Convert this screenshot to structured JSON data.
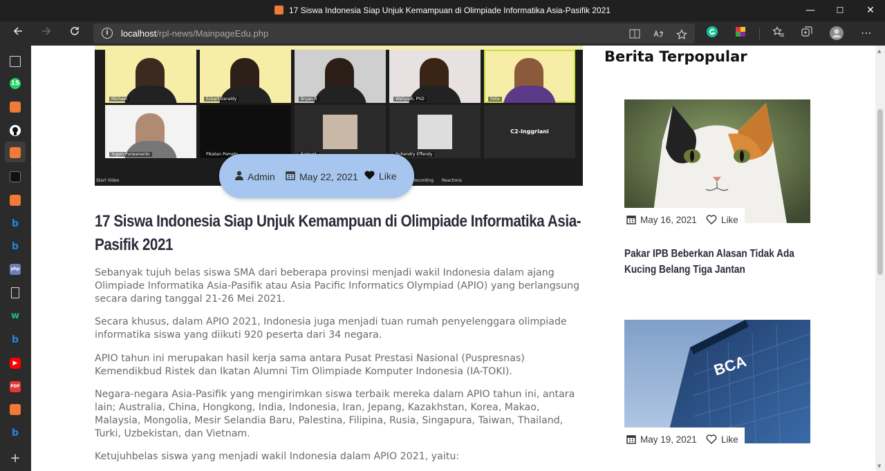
{
  "window": {
    "title": "17 Siswa Indonesia Siap Unjuk Kemampuan di Olimpiade Informatika Asia-Pasifik 2021",
    "controls": {
      "minimize": "—",
      "maximize": "☐",
      "close": "✕"
    }
  },
  "addressbar": {
    "url_host": "localhost",
    "url_path": "/rpl-news/MainpageEdu.php",
    "info_icon": "i"
  },
  "sidebar": {
    "badge_count": "15"
  },
  "hero": {
    "participants": [
      {
        "name": "Michael"
      },
      {
        "name": "Eckart Geraldy"
      },
      {
        "name": "Bryan R"
      },
      {
        "name": "Wahyudi, PhD"
      },
      {
        "name": "Felix"
      },
      {
        "name": "Yugen Purwananto"
      },
      {
        "name": "Pikatan Pomelo"
      },
      {
        "name": "Samuel"
      },
      {
        "name": "Suhendry Effendy"
      },
      {
        "name": "C2-Inggriani"
      }
    ],
    "toolbar": {
      "video": "Start Video",
      "recording": "Recording",
      "reactions": "Reactions"
    }
  },
  "article_meta": {
    "author": "Admin",
    "date": "May 22, 2021",
    "like": "Like"
  },
  "article": {
    "title": "17 Siswa Indonesia Siap Unjuk Kemampuan di Olimpiade Informatika Asia-Pasifik 2021",
    "paragraphs": [
      "Sebanyak tujuh belas siswa SMA dari beberapa provinsi menjadi wakil Indonesia dalam ajang Olimpiade Informatika Asia-Pasifik atau Asia Pacific Informatics Olympiad (APIO) yang berlangsung secara daring tanggal 21-26 Mei 2021.",
      "Secara khusus, dalam APIO 2021, Indonesia juga menjadi tuan rumah penyelenggara olimpiade informatika siswa yang diikuti 920 peserta dari 34 negara.",
      "APIO tahun ini merupakan hasil kerja sama antara Pusat Prestasi Nasional (Puspresnas) Kemendikbud Ristek dan Ikatan Alumni Tim Olimpiade Komputer Indonesia (IA-TOKI).",
      "Negara-negara Asia-Pasifik yang mengirimkan siswa terbaik mereka dalam APIO tahun ini, antara lain; Australia, China, Hongkong, India, Indonesia, Iran, Jepang, Kazakhstan, Korea, Makao, Malaysia, Mongolia, Mesir Selandia Baru, Palestina, Filipina, Rusia, Singapura, Taiwan, Thailand, Turki, Uzbekistan, dan Vietnam.",
      "Ketujuhbelas siswa yang menjadi wakil Indonesia dalam APIO 2021, yaitu:"
    ]
  },
  "sidebar_popular": {
    "heading": "Berita Terpopular",
    "cards": [
      {
        "date": "May 16, 2021",
        "like": "Like",
        "title": "Pakar IPB Beberkan Alasan Tidak Ada Kucing Belang Tiga Jantan"
      },
      {
        "date": "May 19, 2021",
        "like": "Like",
        "title": ""
      }
    ]
  },
  "colors": {
    "pill": "#a7c6ef",
    "title": "#2a2a3a",
    "body_text": "#6a6a6a",
    "browser_chrome": "#2b2b2b"
  }
}
